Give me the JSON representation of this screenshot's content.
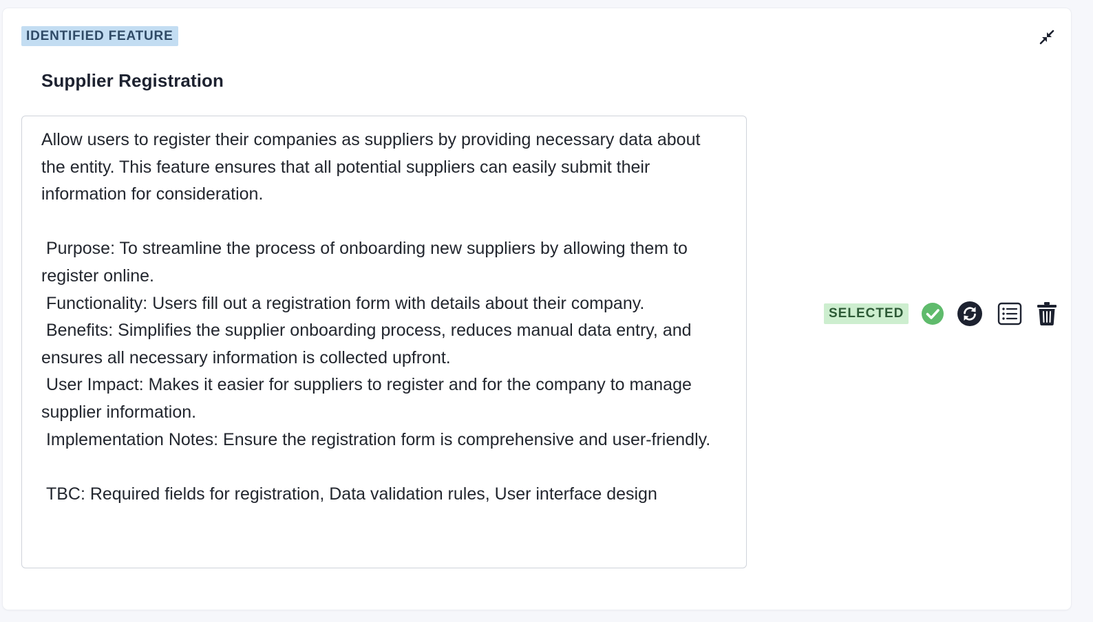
{
  "card": {
    "badge": "IDENTIFIED FEATURE",
    "title": "Supplier Registration",
    "collapse_icon": "collapse-arrows-icon",
    "description": "Allow users to register their companies as suppliers by providing necessary data about the entity. This feature ensures that all potential suppliers can easily submit their information for consideration.\n\n Purpose: To streamline the process of onboarding new suppliers by allowing them to register online.\n Functionality: Users fill out a registration form with details about their company.\n Benefits: Simplifies the supplier onboarding process, reduces manual data entry, and ensures all necessary information is collected upfront.\n User Impact: Makes it easier for suppliers to register and for the company to manage supplier information.\n Implementation Notes: Ensure the registration form is comprehensive and user-friendly.\n\n TBC: Required fields for registration, Data validation rules, User interface design"
  },
  "actions": {
    "status_label": "SELECTED",
    "icons": [
      "check-circle-icon",
      "sync-icon",
      "list-icon",
      "trash-icon"
    ]
  },
  "colors": {
    "feature_badge_bg": "#c3ddf2",
    "selected_badge_bg": "#cdeecf",
    "check_green": "#5fbb6c",
    "icon_dark": "#1d2230"
  }
}
